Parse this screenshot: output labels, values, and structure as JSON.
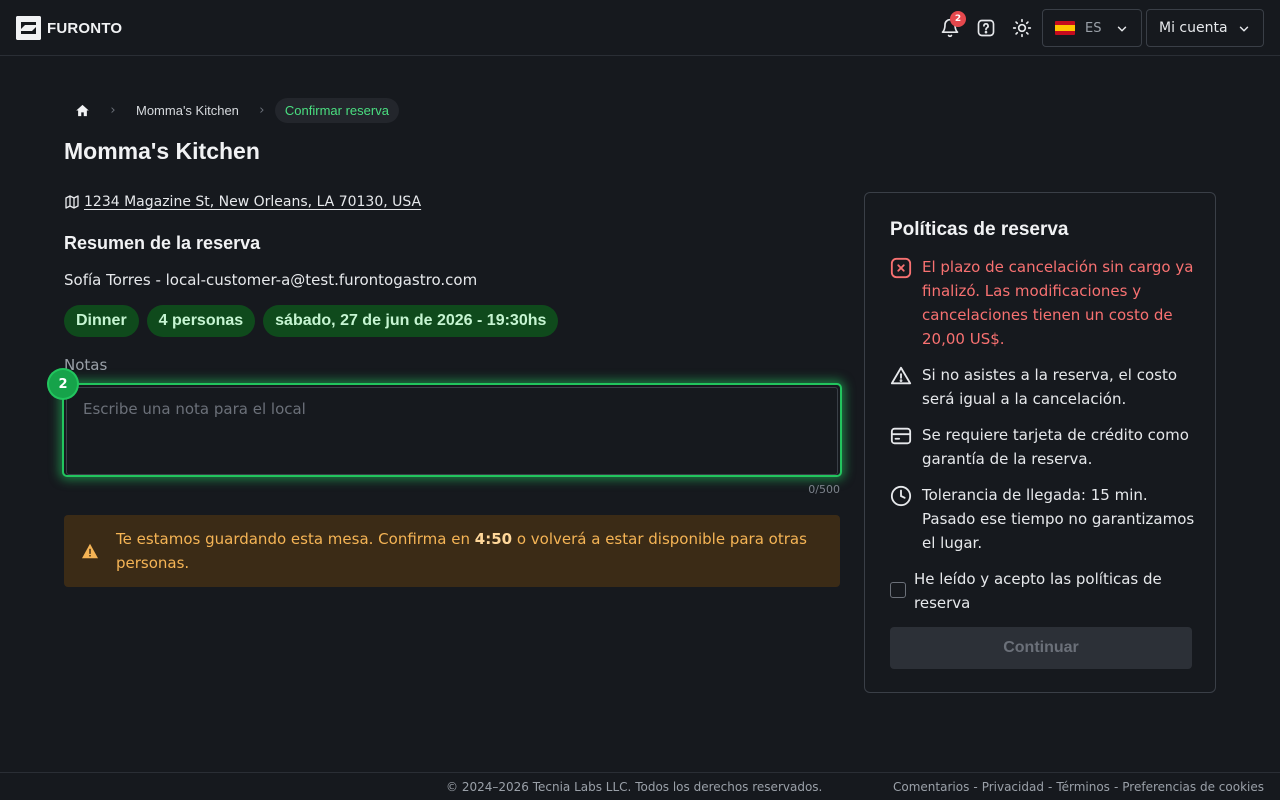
{
  "header": {
    "logo_text": "FURONTO",
    "notifications_count": "2",
    "language_code": "ES",
    "account_label": "Mi cuenta"
  },
  "breadcrumb": {
    "items": [
      "Momma's Kitchen"
    ],
    "current": "Confirmar reserva"
  },
  "restaurant": {
    "name": "Momma's Kitchen",
    "address": "1234 Magazine St, New Orleans, LA 70130, USA"
  },
  "summary": {
    "title": "Resumen de la reserva",
    "customer": "Sofía Torres - local-customer-a@test.furontogastro.com",
    "chips": [
      "Dinner",
      "4 personas",
      "sábado, 27 de jun de 2026 - 19:30hs"
    ]
  },
  "notes": {
    "label": "Notas",
    "placeholder": "Escribe una nota para el local",
    "counter": "0/500",
    "step_badge": "2"
  },
  "hold_alert": {
    "text_before": "Te estamos guardando esta mesa. Confirma en ",
    "timer": "4:50",
    "text_after": " o volverá a estar disponible para otras personas."
  },
  "policies": {
    "title": "Políticas de reserva",
    "items": [
      {
        "icon": "x-circle-icon",
        "text": "El plazo de cancelación sin cargo ya finalizó. Las modificaciones y cancelaciones tienen un costo de 20,00 US$."
      },
      {
        "icon": "warning-icon",
        "text": "Si no asistes a la reserva, el costo será igual a la cancelación."
      },
      {
        "icon": "credit-card-icon",
        "text": "Se requiere tarjeta de crédito como garantía de la reserva."
      },
      {
        "icon": "clock-icon",
        "text": "Tolerancia de llegada: 15 min. Pasado ese tiempo no garantizamos el lugar."
      }
    ],
    "accept_label": "He leído y acepto las políticas de reserva",
    "continue_label": "Continuar"
  },
  "footer": {
    "copyright": "© 2024–2026 Tecnia Labs LLC. Todos los derechos reservados.",
    "links": [
      "Comentarios",
      "Privacidad",
      "Términos",
      "Preferencias de cookies"
    ]
  },
  "colors": {
    "accent_green": "#22c55e",
    "danger_red": "#f87171",
    "warning_amber": "#f5b455",
    "background": "#16191e"
  }
}
